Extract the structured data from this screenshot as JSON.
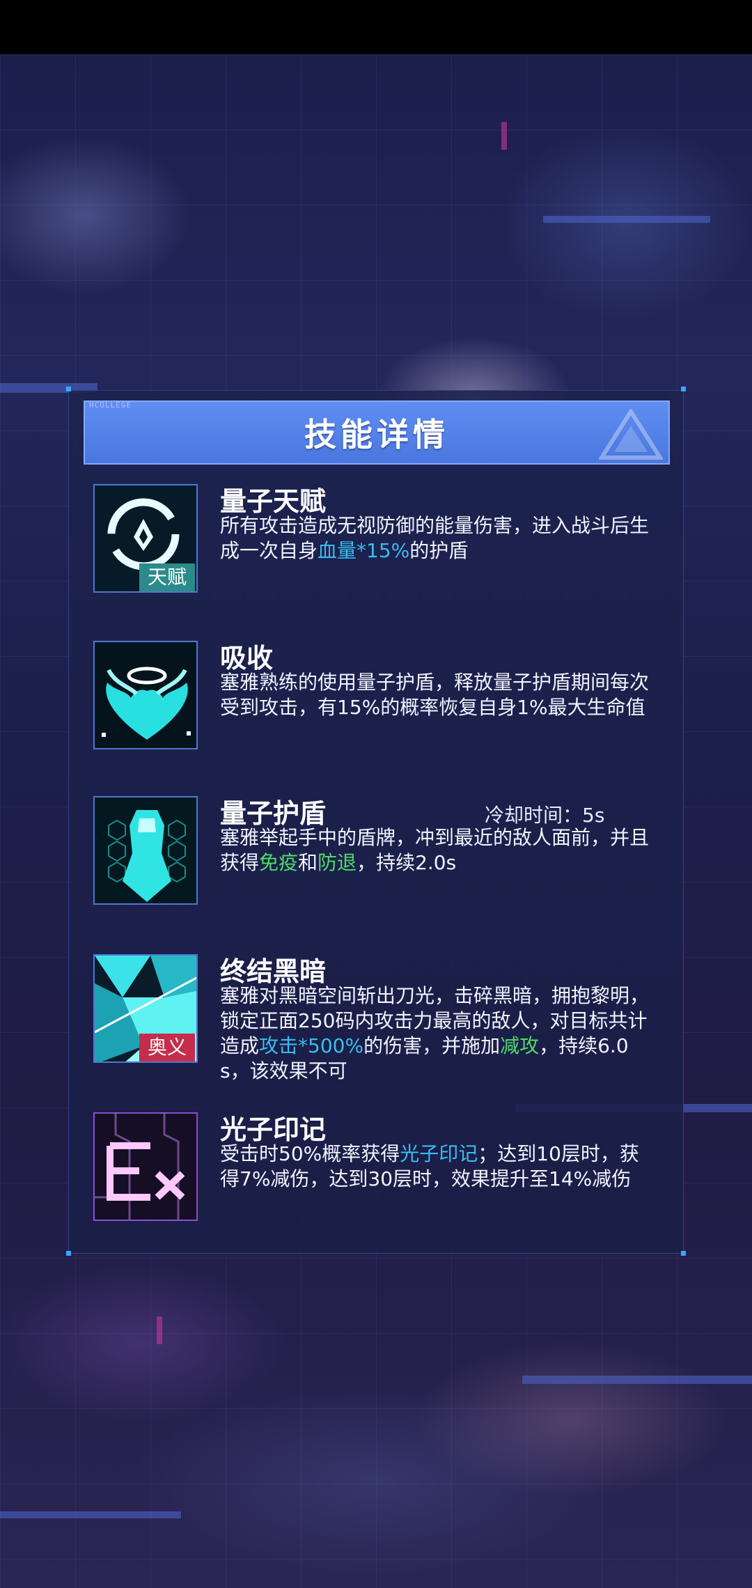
{
  "header": {
    "title": "技能详情",
    "small_text": "HCOLLEGE"
  },
  "skills": [
    {
      "name": "量子天赋",
      "tag": "天赋",
      "icon": "quantum-talent-icon",
      "desc_parts": [
        "所有攻击造成无视防御的能量伤害，进入战斗后生成一次自身",
        "血量*15%",
        "的护盾"
      ]
    },
    {
      "name": "吸收",
      "icon": "absorb-heart-icon",
      "desc": "塞雅熟练的使用量子护盾，释放量子护盾期间每次受到攻击，有15%的概率恢复自身1%最大生命值"
    },
    {
      "name": "量子护盾",
      "cooldown": "冷却时间：5s",
      "icon": "quantum-shield-icon",
      "desc_parts": [
        "塞雅举起手中的盾牌，冲到最近的敌人面前，并且获得",
        "免疫",
        "和",
        "防退",
        "，持续2.0s"
      ]
    },
    {
      "name": "终结黑暗",
      "tag": "奥义",
      "icon": "end-darkness-icon",
      "desc_parts": [
        "塞雅对黑暗空间斩出刀光，击碎黑暗，拥抱黎明，锁定正面250码内攻击力最高的敌人，对目标共计造成",
        "攻击*500%",
        "的伤害，并施加",
        "减攻",
        "，持续6.0s，该效果不可"
      ]
    },
    {
      "name": "光子印记",
      "icon": "ex-photon-icon",
      "desc_parts": [
        "受击时50%概率获得",
        "光子印记",
        "；达到10层时，获得7%减伤，达到30层时，效果提升至14%减伤"
      ]
    }
  ],
  "colors": {
    "accent_blue": "#5f8ef2",
    "highlight_cyan": "#38bdf0",
    "highlight_green": "#4fdc6a",
    "tag_talent": "#2c8a8a",
    "tag_ult": "#c52d4c"
  }
}
